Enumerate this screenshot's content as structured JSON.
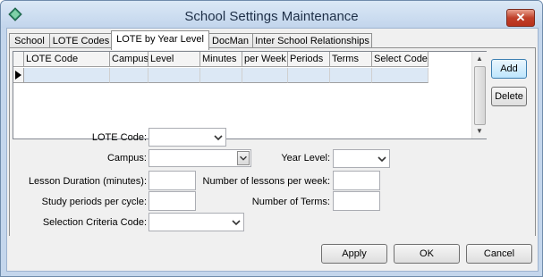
{
  "window": {
    "title": "School Settings Maintenance",
    "close_glyph": "✕"
  },
  "tabs": [
    {
      "label": "School"
    },
    {
      "label": "LOTE Codes"
    },
    {
      "label": "LOTE by Year Level"
    },
    {
      "label": "DocMan"
    },
    {
      "label": "Inter School Relationships"
    }
  ],
  "active_tab": "LOTE by Year Level",
  "grid": {
    "columns": [
      "LOTE Code",
      "Campus",
      "Level",
      "Minutes",
      "per Week",
      "Periods",
      "Terms",
      "Select Code"
    ],
    "rows": [
      [
        "",
        "",
        "",
        "",
        "",
        "",
        "",
        ""
      ]
    ],
    "row_indicator": "current-row-arrow-icon"
  },
  "side_buttons": {
    "add": "Add",
    "delete": "Delete"
  },
  "form": {
    "lote_code": {
      "label": "LOTE Code:",
      "value": ""
    },
    "campus": {
      "label": "Campus:",
      "value": ""
    },
    "year_level": {
      "label": "Year Level:",
      "value": ""
    },
    "lesson_duration": {
      "label": "Lesson Duration (minutes):",
      "value": ""
    },
    "lessons_per_week": {
      "label": "Number of lessons per week:",
      "value": ""
    },
    "study_periods": {
      "label": "Study periods per cycle:",
      "value": ""
    },
    "number_of_terms": {
      "label": "Number of Terms:",
      "value": ""
    },
    "selection_criteria": {
      "label": "Selection Criteria Code:",
      "value": ""
    }
  },
  "footer": {
    "apply": "Apply",
    "ok": "OK",
    "cancel": "Cancel"
  }
}
